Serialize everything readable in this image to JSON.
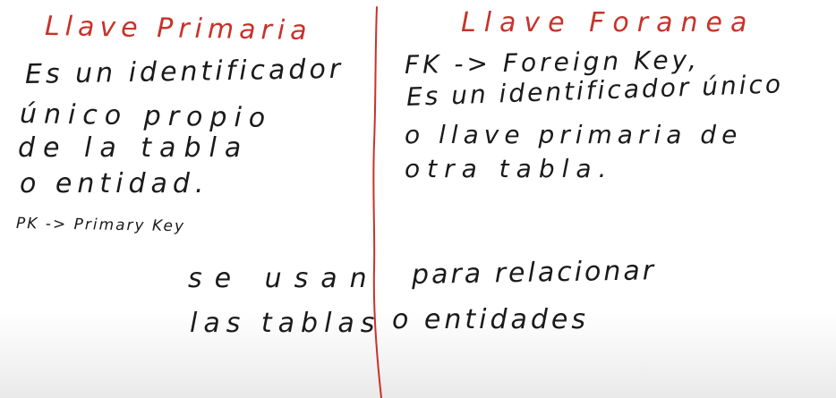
{
  "left_column": {
    "title": "Llave Primaria",
    "lines": [
      "Es un identificador",
      "único propio",
      "de la tabla",
      "o entidad."
    ],
    "abbreviation": "PK -> Primary Key"
  },
  "right_column": {
    "title": "Llave Foranea",
    "lines": [
      "FK -> Foreign Key,",
      "Es un identificador único",
      "o llave primaria de",
      "otra tabla."
    ]
  },
  "footer": {
    "line1_part1": "se usan",
    "line1_part2": "para relacionar",
    "line2_part1": "las tablas",
    "line2_part2": "o entidades"
  },
  "colors": {
    "title": "#c8322a",
    "ink": "#1a1a1a",
    "divider": "#c8322a"
  }
}
